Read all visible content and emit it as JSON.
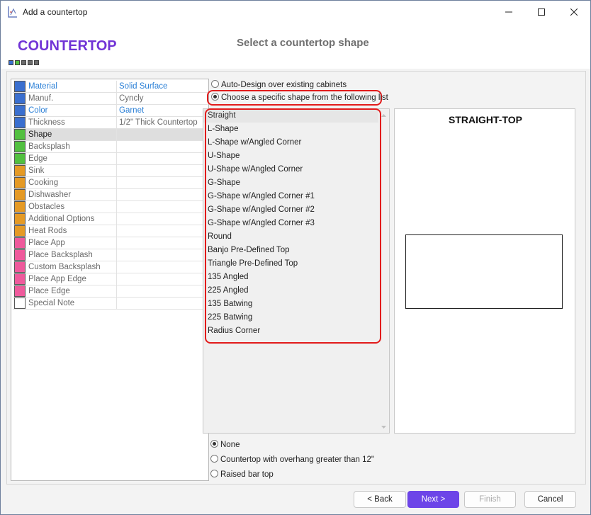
{
  "window": {
    "title": "Add a countertop"
  },
  "header": {
    "brand": "COUNTERTOP",
    "title": "Select a countertop shape",
    "progress_dot_colors": [
      "#3a6fcf",
      "#52c040",
      "#6b6b6b",
      "#6b6b6b",
      "#6b6b6b"
    ]
  },
  "properties": [
    {
      "name": "Material",
      "value": "Solid Surface",
      "color": "#3a6fcf",
      "link": true
    },
    {
      "name": "Manuf.",
      "value": "Cyncly",
      "color": "#3a6fcf",
      "link": false
    },
    {
      "name": "Color",
      "value": "Garnet",
      "color": "#3a6fcf",
      "link": true
    },
    {
      "name": "Thickness",
      "value": "1/2\" Thick Countertop",
      "color": "#3a6fcf",
      "link": false
    },
    {
      "name": "Shape",
      "value": "",
      "color": "#52c040",
      "link": false,
      "selected": true
    },
    {
      "name": "Backsplash",
      "value": "",
      "color": "#52c040",
      "link": false
    },
    {
      "name": "Edge",
      "value": "",
      "color": "#52c040",
      "link": false
    },
    {
      "name": "Sink",
      "value": "",
      "color": "#e59a25",
      "link": false
    },
    {
      "name": "Cooking",
      "value": "",
      "color": "#e59a25",
      "link": false
    },
    {
      "name": "Dishwasher",
      "value": "",
      "color": "#e59a25",
      "link": false
    },
    {
      "name": "Obstacles",
      "value": "",
      "color": "#e59a25",
      "link": false
    },
    {
      "name": "Additional Options",
      "value": "",
      "color": "#e59a25",
      "link": false
    },
    {
      "name": "Heat Rods",
      "value": "",
      "color": "#e59a25",
      "link": false
    },
    {
      "name": "Place App",
      "value": "",
      "color": "#ef5a9c",
      "link": false
    },
    {
      "name": "Place Backsplash",
      "value": "",
      "color": "#ef5a9c",
      "link": false
    },
    {
      "name": "Custom Backsplash",
      "value": "",
      "color": "#ef5a9c",
      "link": false
    },
    {
      "name": "Place App Edge",
      "value": "",
      "color": "#ef5a9c",
      "link": false
    },
    {
      "name": "Place Edge",
      "value": "",
      "color": "#ef5a9c",
      "link": false
    },
    {
      "name": "Special Note",
      "value": "",
      "color": "#ffffff",
      "link": false
    }
  ],
  "mode_options": {
    "auto": "Auto-Design over existing cabinets",
    "specific": "Choose a specific shape from the following list"
  },
  "shapes": [
    "Straight",
    "L-Shape",
    "L-Shape w/Angled Corner",
    "U-Shape",
    "U-Shape w/Angled Corner",
    "G-Shape",
    "G-Shape w/Angled Corner #1",
    "G-Shape w/Angled Corner #2",
    "G-Shape w/Angled Corner #3",
    "Round",
    "Banjo Pre-Defined Top",
    "Triangle Pre-Defined Top",
    "135 Angled",
    "225 Angled",
    "135 Batwing",
    "225 Batwing",
    "Radius Corner"
  ],
  "selected_shape": "Straight",
  "preview": {
    "title": "STRAIGHT-TOP"
  },
  "overhang_options": {
    "none": "None",
    "overhang": "Countertop with overhang greater than 12\"",
    "raised": "Raised bar top"
  },
  "buttons": {
    "back": "< Back",
    "next": "Next >",
    "finish": "Finish",
    "cancel": "Cancel"
  },
  "colors": {
    "brand": "#7134d6",
    "accent": "#6d45e8",
    "highlight": "#e21b1b",
    "link": "#2a7fd6"
  }
}
